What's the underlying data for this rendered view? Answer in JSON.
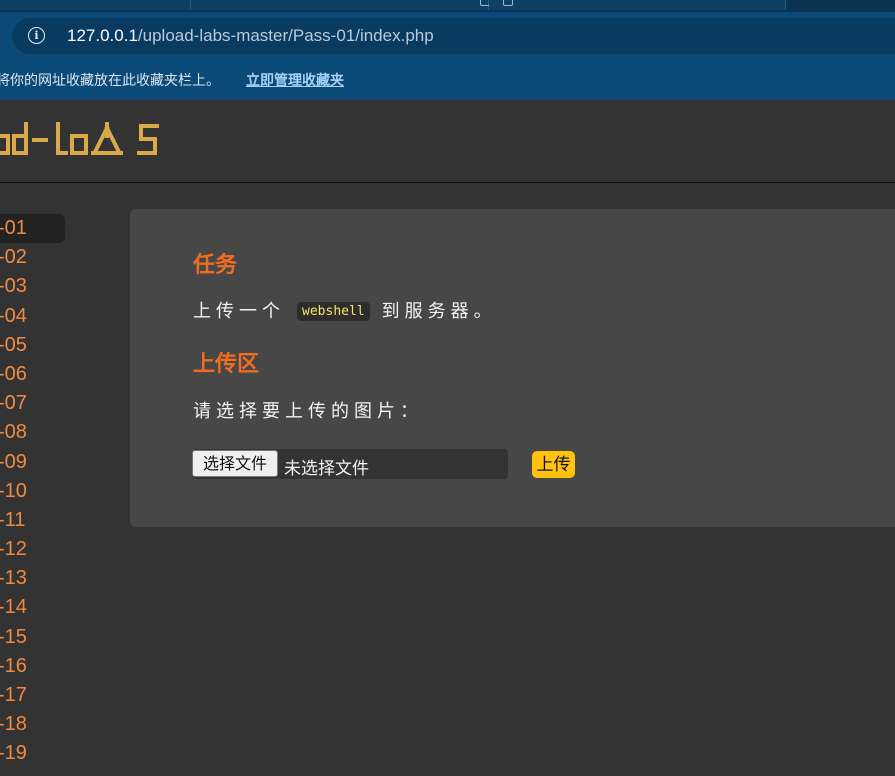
{
  "browser": {
    "url_host": "127.0.0.1",
    "url_path": "/upload-labs-master/Pass-01/index.php",
    "bookmark_hint": "将你的网址收藏放在此收藏夹栏上。",
    "bookmark_link": "立即管理收藏夹"
  },
  "header": {
    "logo_text": "upload-labs"
  },
  "sidebar": {
    "active": "-01",
    "items": [
      "-01",
      "-02",
      "-03",
      "-04",
      "-05",
      "-06",
      "-07",
      "-08",
      "-09",
      "-10",
      "-11",
      "-12",
      "-13",
      "-14",
      "-15",
      "-16",
      "-17",
      "-18",
      "-19"
    ]
  },
  "main": {
    "task_heading": "任务",
    "task_before": "上传一个",
    "task_code": "webshell",
    "task_after": "到服务器。",
    "upload_heading": "上传区",
    "prompt": "请选择要上传的图片：",
    "choose_file_label": "选择文件",
    "no_file_text": "未选择文件",
    "upload_button": "上传"
  },
  "colors": {
    "accent_heading": "#f06d1f",
    "sidebar_link": "#f08a42",
    "upload_button": "#ffc20e",
    "code_text": "#f5e56b",
    "browser_chrome": "#0b4a78"
  }
}
